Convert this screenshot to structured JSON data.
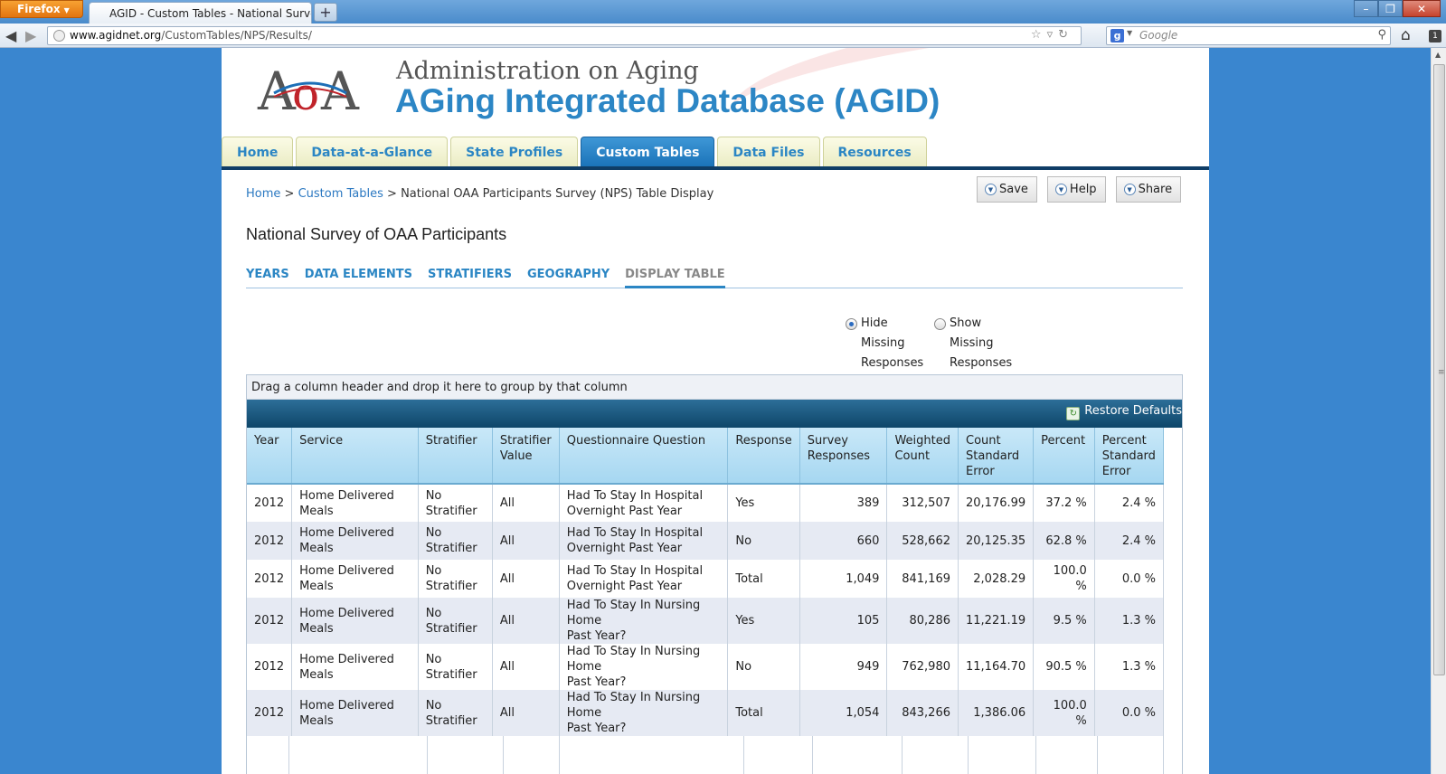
{
  "browser": {
    "menu_button": "Firefox",
    "tab_title": "AGID - Custom Tables - National Survey ...",
    "new_tab": "+",
    "url_domain": "www.agidnet.org",
    "url_path": "/CustomTables/NPS/Results/",
    "search_placeholder": "Google"
  },
  "header": {
    "org_name": "Administration on Aging",
    "site_title": "AGing Integrated Database (AGID)",
    "logo_alt": "AoA"
  },
  "main_tabs": [
    {
      "label": "Home"
    },
    {
      "label": "Data-at-a-Glance"
    },
    {
      "label": "State Profiles"
    },
    {
      "label": "Custom Tables",
      "active": true
    },
    {
      "label": "Data Files"
    },
    {
      "label": "Resources"
    }
  ],
  "breadcrumb": {
    "home": "Home",
    "sep1": " > ",
    "custom_tables": "Custom Tables",
    "sep2": " > ",
    "current": "National OAA Participants Survey (NPS) Table Display"
  },
  "actions": {
    "save": "Save",
    "help": "Help",
    "share": "Share"
  },
  "page_title": "National Survey of OAA Participants",
  "sub_tabs": [
    {
      "label": "YEARS"
    },
    {
      "label": "DATA ELEMENTS"
    },
    {
      "label": "STRATIFIERS"
    },
    {
      "label": "GEOGRAPHY"
    },
    {
      "label": "DISPLAY TABLE",
      "active": true
    }
  ],
  "missing_options": {
    "hide": {
      "line1": "Hide",
      "line2": "Missing",
      "line3": "Responses",
      "checked": true
    },
    "show": {
      "line1": "Show",
      "line2": "Missing",
      "line3": "Responses",
      "checked": false
    }
  },
  "grid": {
    "group_hint": "Drag a column header and drop it here to group by that column",
    "restore_defaults": "Restore Defaults",
    "columns": [
      {
        "line1": "Year",
        "line2": "",
        "line3": ""
      },
      {
        "line1": "Service",
        "line2": "",
        "line3": ""
      },
      {
        "line1": "Stratifier",
        "line2": "",
        "line3": ""
      },
      {
        "line1": "Stratifier",
        "line2": "Value",
        "line3": ""
      },
      {
        "line1": "Questionnaire Question",
        "line2": "",
        "line3": ""
      },
      {
        "line1": "Response",
        "line2": "",
        "line3": ""
      },
      {
        "line1": "Survey",
        "line2": "Responses",
        "line3": ""
      },
      {
        "line1": "Weighted",
        "line2": "Count",
        "line3": ""
      },
      {
        "line1": "Count",
        "line2": "Standard",
        "line3": "Error"
      },
      {
        "line1": "Percent",
        "line2": "",
        "line3": ""
      },
      {
        "line1": "Percent",
        "line2": "Standard",
        "line3": "Error"
      }
    ],
    "rows": [
      {
        "year": "2012",
        "service": "Home Delivered Meals",
        "strat1": "No",
        "strat2": "Stratifier",
        "value": "All",
        "q1": "Had To Stay In Hospital",
        "q2": "Overnight Past Year",
        "response": "Yes",
        "survey": "389",
        "weighted": "312,507",
        "count_se": "20,176.99",
        "percent": "37.2 %",
        "pct_se": "2.4 %"
      },
      {
        "year": "2012",
        "service": "Home Delivered Meals",
        "strat1": "No",
        "strat2": "Stratifier",
        "value": "All",
        "q1": "Had To Stay In Hospital",
        "q2": "Overnight Past Year",
        "response": "No",
        "survey": "660",
        "weighted": "528,662",
        "count_se": "20,125.35",
        "percent": "62.8 %",
        "pct_se": "2.4 %"
      },
      {
        "year": "2012",
        "service": "Home Delivered Meals",
        "strat1": "No",
        "strat2": "Stratifier",
        "value": "All",
        "q1": "Had To Stay In Hospital",
        "q2": "Overnight Past Year",
        "response": "Total",
        "survey": "1,049",
        "weighted": "841,169",
        "count_se": "2,028.29",
        "percent": "100.0 %",
        "pct_se": "0.0 %"
      },
      {
        "year": "2012",
        "service": "Home Delivered Meals",
        "strat1": "No",
        "strat2": "Stratifier",
        "value": "All",
        "q1": "Had To Stay In Nursing Home",
        "q2": "Past Year?",
        "response": "Yes",
        "survey": "105",
        "weighted": "80,286",
        "count_se": "11,221.19",
        "percent": "9.5 %",
        "pct_se": "1.3 %"
      },
      {
        "year": "2012",
        "service": "Home Delivered Meals",
        "strat1": "No",
        "strat2": "Stratifier",
        "value": "All",
        "q1": "Had To Stay In Nursing Home",
        "q2": "Past Year?",
        "response": "No",
        "survey": "949",
        "weighted": "762,980",
        "count_se": "11,164.70",
        "percent": "90.5 %",
        "pct_se": "1.3 %"
      },
      {
        "year": "2012",
        "service": "Home Delivered Meals",
        "strat1": "No",
        "strat2": "Stratifier",
        "value": "All",
        "q1": "Had To Stay In Nursing Home",
        "q2": "Past Year?",
        "response": "Total",
        "survey": "1,054",
        "weighted": "843,266",
        "count_se": "1,386.06",
        "percent": "100.0 %",
        "pct_se": "0.0 %"
      }
    ]
  }
}
